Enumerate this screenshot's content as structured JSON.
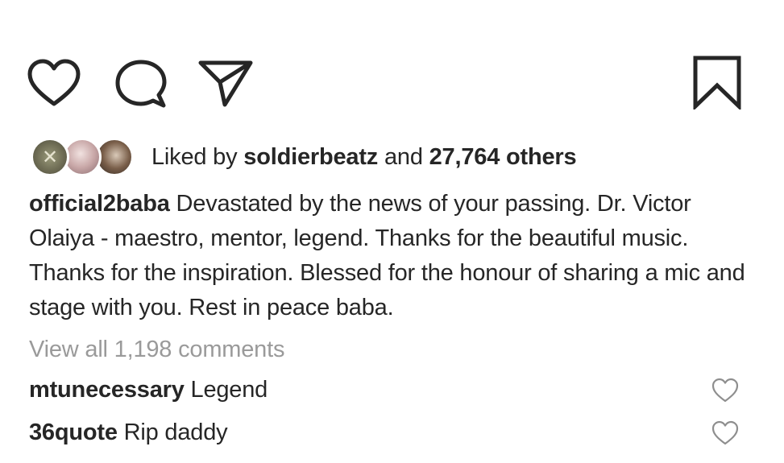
{
  "actions": {
    "like_icon": "heart-outline",
    "comment_icon": "speech-bubble",
    "share_icon": "paper-plane",
    "save_icon": "bookmark"
  },
  "likes": {
    "prefix": "Liked by",
    "user": "soldierbeatz",
    "conjunction": "and",
    "others": "27,764 others"
  },
  "caption": {
    "username": "official2baba",
    "text": "Devastated by the news of your passing. Dr. Victor Olaiya - maestro, mentor, legend. Thanks for the beautiful music. Thanks for the inspiration. Blessed for the honour of sharing a mic and stage with you. Rest in peace baba."
  },
  "view_all_comments": "View all 1,198 comments",
  "comments": [
    {
      "username": "mtunecessary",
      "text": "Legend"
    },
    {
      "username": "36quote",
      "text": "Rip daddy"
    }
  ],
  "colors": {
    "text": "#262626",
    "muted": "#9a9a9a",
    "background": "#ffffff"
  }
}
